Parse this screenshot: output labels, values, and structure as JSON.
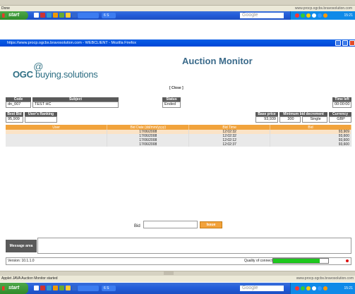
{
  "browser": {
    "top_status": "Done",
    "top_url": "www.procp.ogcbs.bravosolution.com",
    "window_title": "https://www.procp.ogcbs.bravosolution.com - WEBCLIENT - Mozilla Firefox",
    "bottom_status": "Applet JAVA Auction Monitor started",
    "bottom_url": "www.procp.ogcbs.bravosolution.com"
  },
  "taskbar": {
    "start_label": "start",
    "task_label": "6 S",
    "search_placeholder": "Google",
    "clock": "15:21"
  },
  "page": {
    "logo_mark": "@",
    "logo_text_1": "OGC",
    "logo_text_2": " buying.solutions",
    "title": "Auction Monitor",
    "close_label": "[ Close ]"
  },
  "fields": {
    "code_label": "Code",
    "code_value": "dn_007",
    "subject_label": "Subject",
    "subject_value": "TEST HC",
    "status_label": "Status",
    "status_value": "Ended",
    "time_left_label": "Time left",
    "time_left_value": "00:00:00",
    "best_bid_label": "Best Bid",
    "best_bid_value": "95,909",
    "user_ranking_label": "User's Ranking",
    "user_ranking_value": "",
    "base_price_label": "Base price",
    "base_price_value": "93,939",
    "min_decrement_label": "Minimum bid decrement",
    "min_decrement_value": "300",
    "min_decrement_unit": "Single",
    "currency_label": "Currency",
    "currency_value": "GBP"
  },
  "table": {
    "headers": [
      "User",
      "Bid Date (dd/mm/yyyy)",
      "Bid Time",
      "Bid"
    ],
    "rows": [
      {
        "user": "",
        "date": "17/06/2008",
        "time": "12:02:32",
        "bid": "93,909"
      },
      {
        "user": "",
        "date": "17/06/2008",
        "time": "12:02:32",
        "bid": "93,600"
      },
      {
        "user": "",
        "date": "17/06/2008",
        "time": "12:02:12",
        "bid": "93,600"
      },
      {
        "user": "",
        "date": "17/06/2008",
        "time": "12:02:37",
        "bid": "93,600"
      }
    ]
  },
  "bid_form": {
    "bid_label": "Bid",
    "submit_label": "Issue"
  },
  "message": {
    "label": "Message area"
  },
  "footer": {
    "version": "Version: 10.1.1.0",
    "quality_label": "Quality of connection:",
    "quality_level": 0.85
  },
  "colors": {
    "accent": "#f2a23a",
    "title": "#3a6a8a",
    "label_bg": "#5a5a5a",
    "good": "#1ec81e"
  }
}
